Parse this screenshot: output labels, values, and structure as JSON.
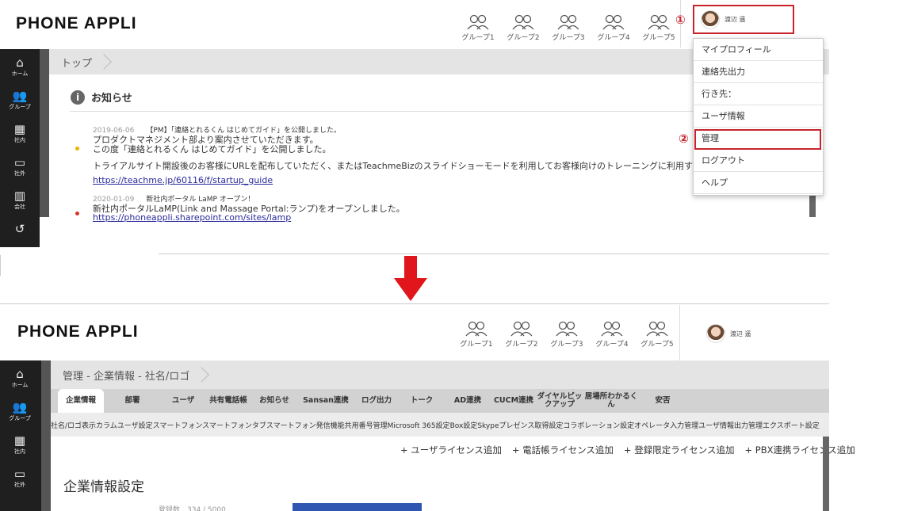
{
  "top": {
    "logo": "PHONE APPLI",
    "groups": [
      "グループ1",
      "グループ2",
      "グループ3",
      "グループ4",
      "グループ5"
    ],
    "user_name": "渡辺 遥",
    "annotation_1": "①",
    "annotation_2": "②",
    "breadcrumb": "トップ",
    "sidebar": [
      {
        "label": "ホーム",
        "icon": "home-icon",
        "glyph": "⌂"
      },
      {
        "label": "グループ",
        "icon": "group-icon",
        "glyph": "👥"
      },
      {
        "label": "社内",
        "icon": "building-icon",
        "glyph": "▦"
      },
      {
        "label": "社外",
        "icon": "id-card-icon",
        "glyph": "▭"
      },
      {
        "label": "会社",
        "icon": "company-icon",
        "glyph": "▥"
      },
      {
        "label": "",
        "icon": "history-icon",
        "glyph": "↺"
      }
    ],
    "notice": {
      "title": "お知らせ",
      "items": [
        {
          "date": "2019-06-06",
          "headline": "【PM】「連絡とれるくん はじめてガイド」を公開しました。",
          "body1": "プロダクトマネジメント部より案内させていただきます。",
          "body2": "この度「連絡とれるくん はじめてガイド」を公開しました。",
          "body3": "トライアルサイト開設後のお客様にURLを配布していただく、またはTeachmeBizのスライドショーモードを利用してお客様向けのトレーニングに利用するな",
          "link": "https://teachme.jp/60116/f/startup_guide",
          "dot_color": "#e8b400"
        },
        {
          "date": "2020-01-09",
          "headline": "新社内ポータル LaMP オープン！",
          "body1": "新社内ポータルLaMP(Link and Massage Portal:ランプ)をオープンしました。",
          "link": "https://phoneappli.sharepoint.com/sites/lamp",
          "dot_color": "#d9342b"
        }
      ]
    },
    "dropdown": [
      "マイプロフィール",
      "連絡先出力",
      "行き先：",
      "ユーザ情報",
      "管理",
      "ログアウト",
      "ヘルプ"
    ]
  },
  "arrow_color": "#e0161c",
  "bottom": {
    "logo": "PHONE APPLI",
    "groups": [
      "グループ1",
      "グループ2",
      "グループ3",
      "グループ4",
      "グループ5"
    ],
    "user_name": "渡辺 遥",
    "breadcrumb": "管理 - 企業情報 - 社名/ロゴ",
    "sidebar": [
      {
        "label": "ホーム",
        "icon": "home-icon",
        "glyph": "⌂"
      },
      {
        "label": "グループ",
        "icon": "group-icon",
        "glyph": "👥"
      },
      {
        "label": "社内",
        "icon": "building-icon",
        "glyph": "▦"
      },
      {
        "label": "社外",
        "icon": "id-card-icon",
        "glyph": "▭"
      }
    ],
    "tabs": [
      "企業情報",
      "部署",
      "ユーザ",
      "共有電話帳",
      "お知らせ",
      "Sansan連携",
      "ログ出力",
      "トーク",
      "AD連携",
      "CUCM連携",
      "ダイヤルピックアップ",
      "居場所わかるくん",
      "安否"
    ],
    "subtabs": "社名/ロゴ表示カラムユーザ設定スマートフォンスマートフォンタブスマートフォン発信機能共用番号管理Microsoft 365設定Box設定Skypeプレゼンス取得設定コラボレーション設定オペレータ入力管理ユーザ情報出力管理エクスポート設定",
    "add_links": [
      "+ ユーザライセンス追加",
      "+ 電話帳ライセンス追加",
      "+ 登録限定ライセンス追加",
      "+ PBX連携ライセンス追加"
    ],
    "section_title": "企業情報設定",
    "partial_row": "登録数　334 / 5000",
    "accent": "#2f56b0"
  }
}
